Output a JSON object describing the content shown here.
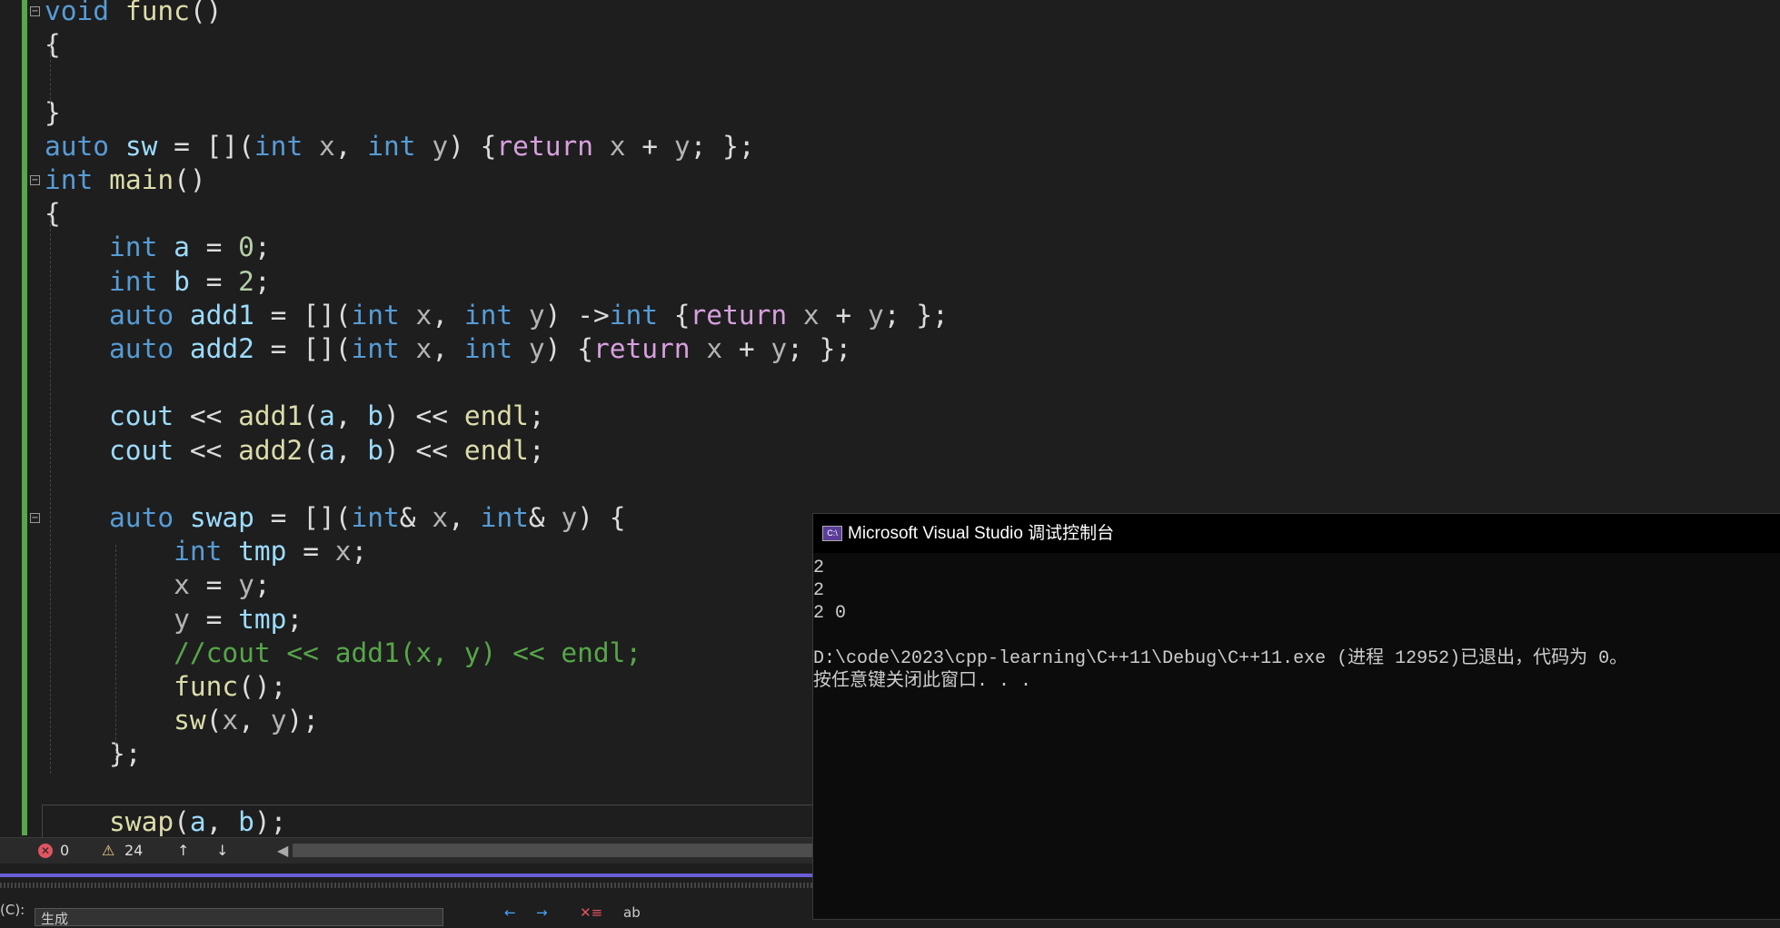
{
  "editor": {
    "code_lines": [
      "void func()",
      "{",
      "",
      "}",
      "auto sw = [](int x, int y) {return x + y; };",
      "int main()",
      "{",
      "    int a = 0;",
      "    int b = 2;",
      "    auto add1 = [](int x, int y) ->int {return x + y; };",
      "    auto add2 = [](int x, int y) {return x + y; };",
      "",
      "    cout << add1(a, b) << endl;",
      "    cout << add2(a, b) << endl;",
      "",
      "    auto swap = [](int& x, int& y) {",
      "        int tmp = x;",
      "        x = y;",
      "        y = tmp;",
      "        //cout << add1(x, y) << endl;",
      "        func();",
      "        sw(x, y);",
      "    };",
      "",
      "    swap(a, b);"
    ]
  },
  "status": {
    "errors": "0",
    "warnings": "24",
    "up_icon": "arrow-up-icon",
    "down_icon": "arrow-down-icon"
  },
  "bottom": {
    "label": "(C):",
    "field_value": "生成"
  },
  "console": {
    "title": "Microsoft Visual Studio 调试控制台",
    "icon_text": "C:\\",
    "output": [
      "2",
      "2",
      "2 0",
      "",
      "D:\\code\\2023\\cpp-learning\\C++11\\Debug\\C++11.exe (进程 12952)已退出，代码为 0。",
      "按任意键关闭此窗口. . ."
    ]
  },
  "colors": {
    "keyword": "#569cd6",
    "function": "#dcdcaa",
    "variable": "#9cdcfe",
    "control": "#d8a0df",
    "comment": "#57a64a",
    "accent": "#6a5ed8"
  }
}
